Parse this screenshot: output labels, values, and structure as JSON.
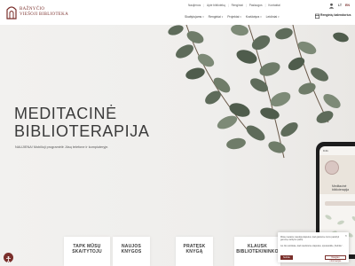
{
  "header": {
    "logo": {
      "line1": "BAŽNYČIO",
      "line2": "VIEŠOJI BIBLIOTEKA"
    },
    "top_links": [
      "Naujienos",
      "Apie biblioteką",
      "Renginiai",
      "Paslaugos",
      "Kontaktai"
    ],
    "languages": {
      "current": "LT",
      "other": "EN"
    },
    "main_menu": [
      {
        "label": "Skaitytojams"
      },
      {
        "label": "Renginiai"
      },
      {
        "label": "Projektai"
      },
      {
        "label": "Kraštotyra"
      },
      {
        "label": "Leidiniai"
      }
    ],
    "calendar_button": "Renginių kalendorius"
  },
  "hero": {
    "title_line1": "MEDITACINĖ",
    "title_line2": "BIBLIOTERAPIJA",
    "subtitle": "NAUJIENA! Mobilioji programėlė Jūsų telefone ir kompiuteryje."
  },
  "phone": {
    "status_time": "9:41",
    "title_line1": "Meditacinė",
    "title_line2": "biblioterapija"
  },
  "cards": [
    {
      "line1": "TAPK MŪSŲ",
      "line2": "SKAITYTOJU"
    },
    {
      "line1": "NAUJOS",
      "line2": "KNYGOS"
    },
    {
      "line1": "PRATĘSK",
      "line2": "KNYGĄ"
    },
    {
      "line1": "KLAUSK",
      "line2": "BIBLIOTEKININKO"
    }
  ],
  "cookie": {
    "text1": "Mūsų svetainė naudoja slapukus, kad galėtume Jums pasiūlyti geresnę naršymo patirtį.",
    "text2": "Jei Jūs sutinkate, kad naudotume slapukus, spustelėkite „Sutinku“.",
    "accept": "Sutinku",
    "more": "Daugiau informacijos"
  },
  "colors": {
    "brand": "#7a2f2b",
    "leaf": "#5e6b5a"
  }
}
